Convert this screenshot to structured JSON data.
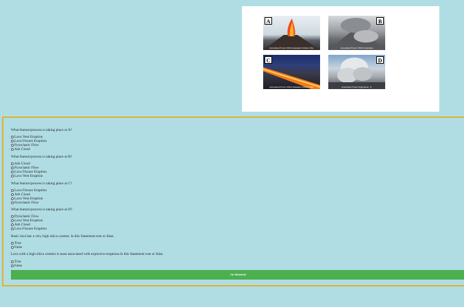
{
  "images": [
    {
      "label": "A",
      "caption": "Associated Press/ USGS Hawaiian Volcano Obs."
    },
    {
      "label": "B",
      "caption": "Associated Press/ USGS Cascades"
    },
    {
      "label": "C",
      "caption": "Associated Press/ USGS Hawaiian Volcano Obs."
    },
    {
      "label": "D",
      "caption": "Associated Press/ Sigurdsson, S."
    }
  ],
  "questions": [
    {
      "text": "What feature/process is taking place at A?",
      "options": [
        "Lava Vent Eruption",
        "Lava Fissure Eruption",
        "Pyroclastic Flow",
        "Ash Cloud"
      ]
    },
    {
      "text": "What feature/process is taking place at B?",
      "options": [
        "Ash Cloud",
        "Pyroclastic Flow",
        "Lava Fissure Eruption",
        "Lava Vent Eruption"
      ]
    },
    {
      "text": "What feature/process is taking place at C?",
      "options": [
        "Lava Fissure Eruption",
        "Ash Cloud",
        "Lava Vent Eruption",
        "Pyroclastic Flow"
      ]
    },
    {
      "text": "What feature/process is taking place at D?",
      "options": [
        "Pyroclastic Flow",
        "Lava Vent Eruption",
        "Ash Cloud",
        "Lava Fissure Eruption"
      ]
    },
    {
      "text": "Basic lava has a very high silica content. Is this Statement true or false.",
      "options": [
        "True",
        "False"
      ]
    },
    {
      "text": "Lava with a high silica content is most associated with explosive eruptions.Is this Statement true or false.",
      "options": [
        "True",
        "False"
      ]
    }
  ],
  "finish_label": "I'm finished!",
  "colors": {
    "background": "#b0dde4",
    "quiz_border": "#e1b12c",
    "finish_button": "#4caf50"
  }
}
